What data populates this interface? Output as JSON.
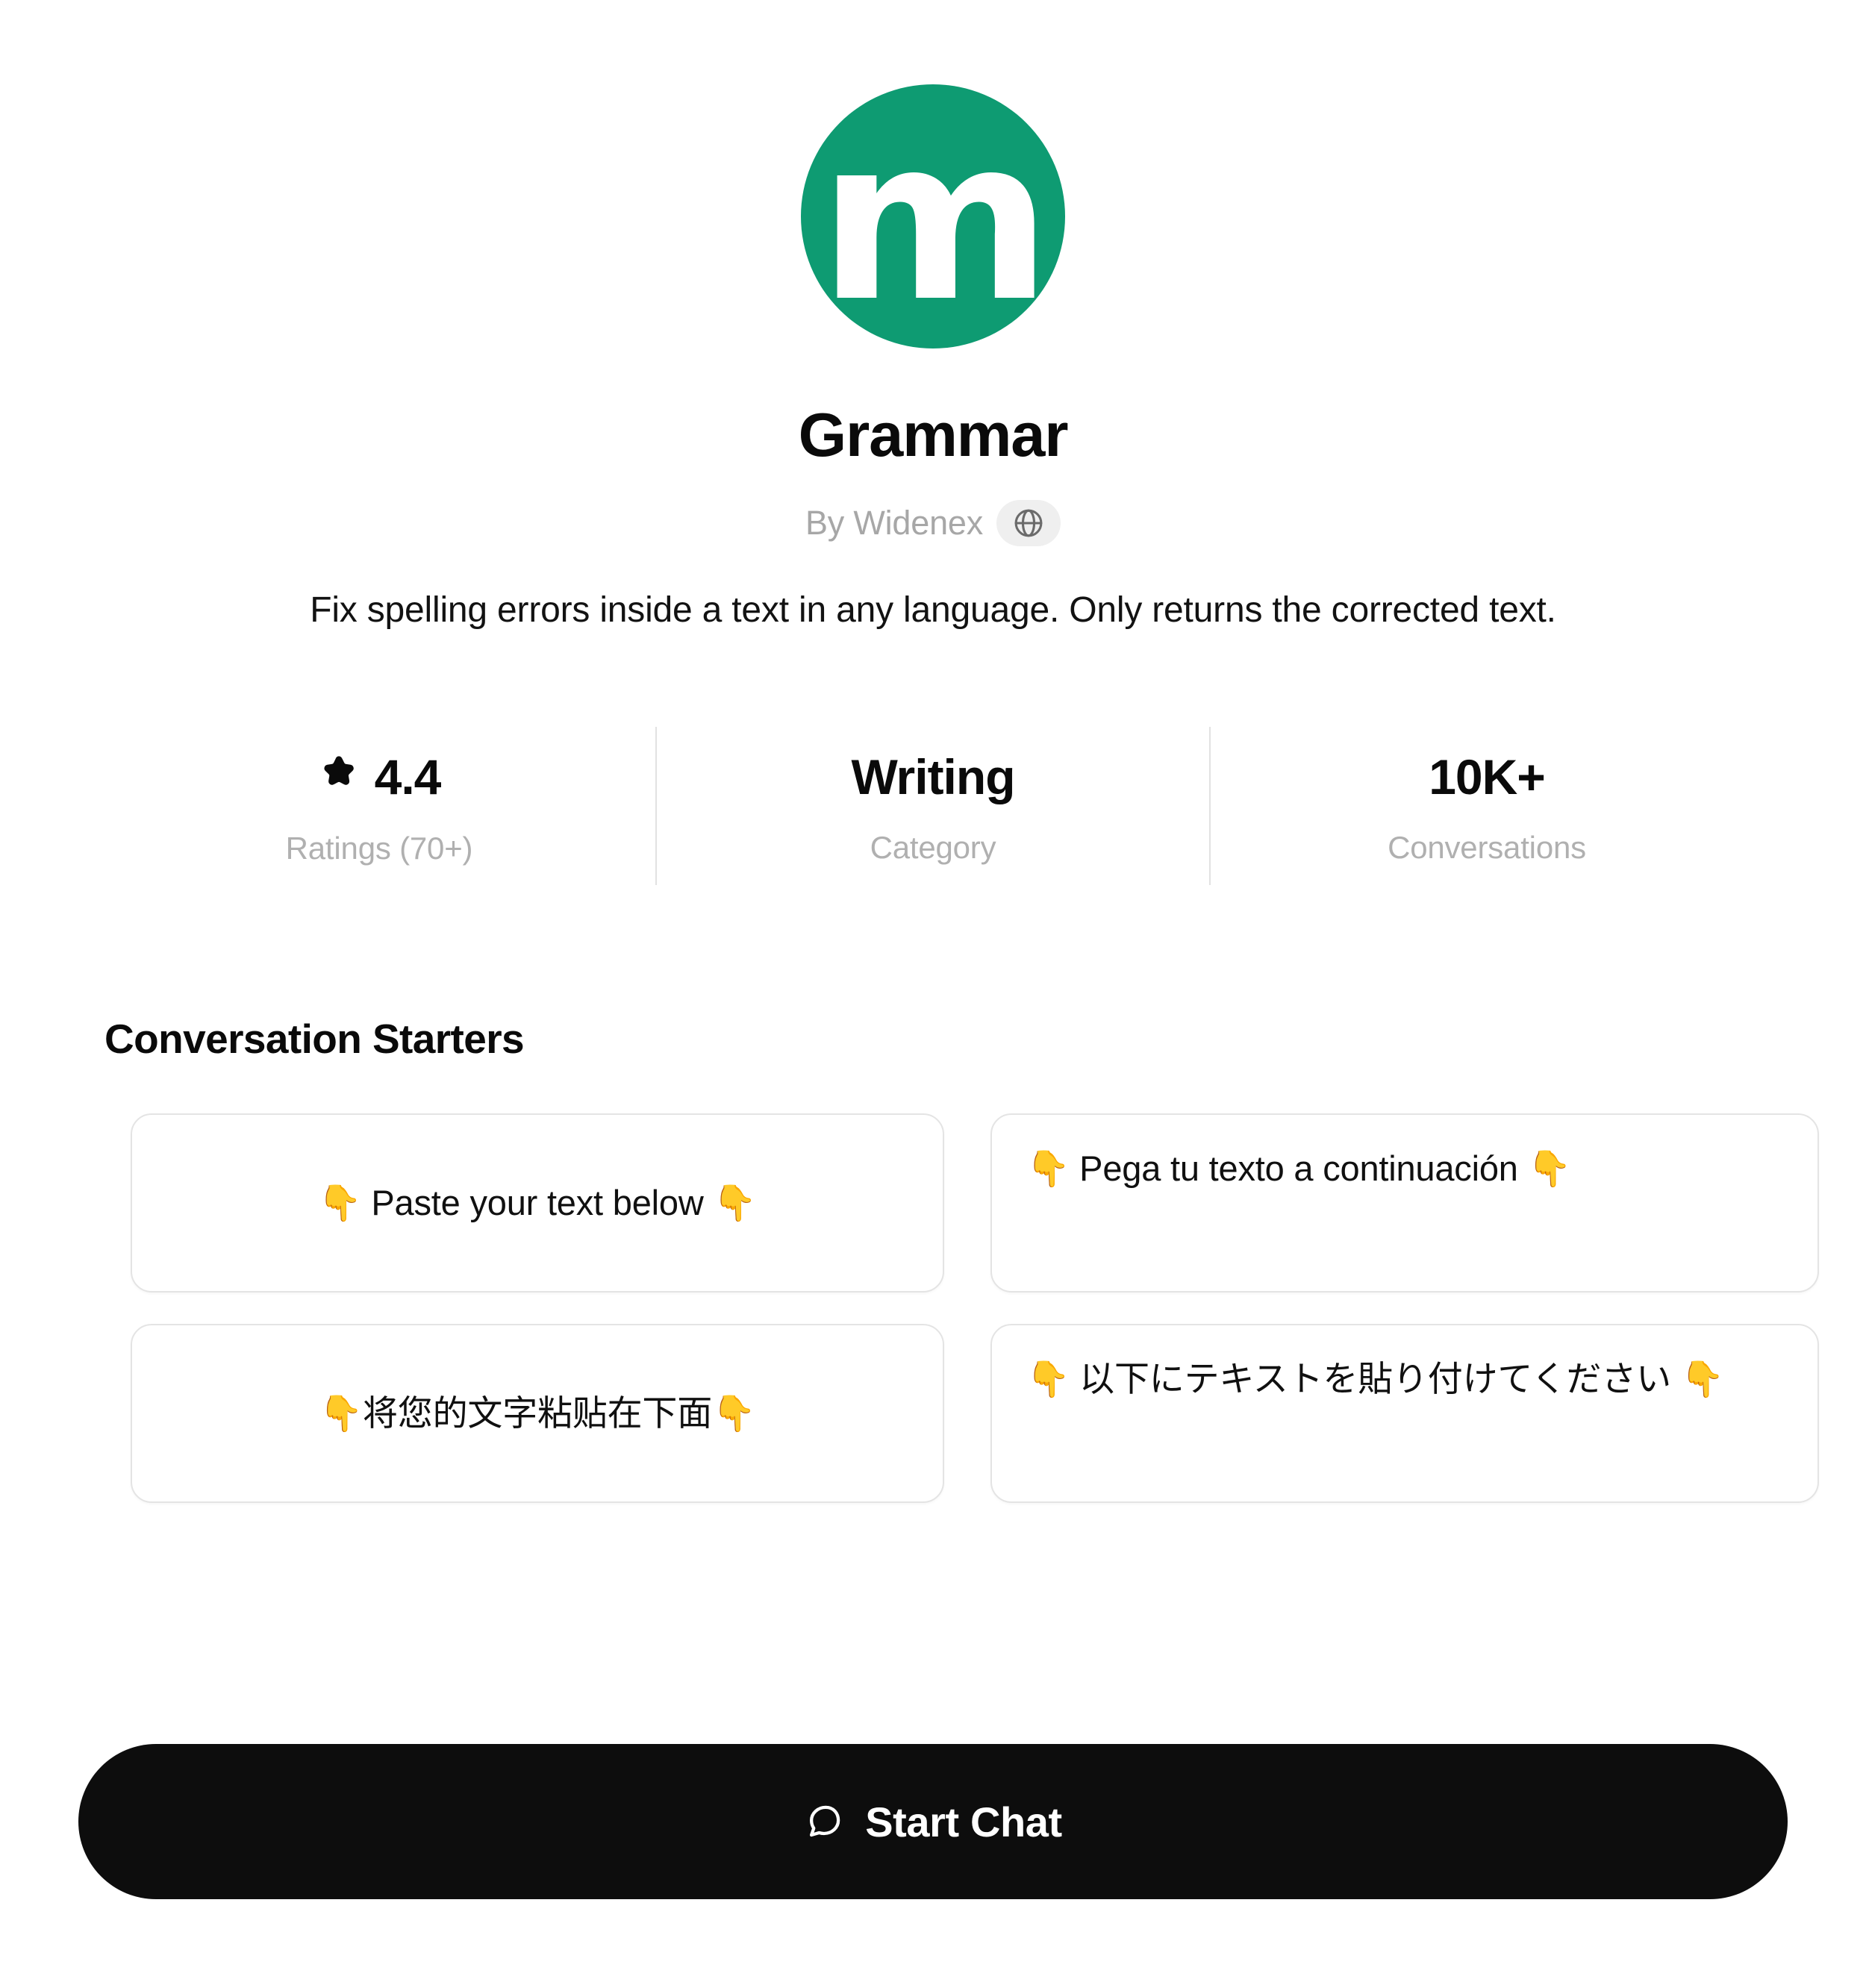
{
  "app": {
    "logo_letter": "m",
    "logo_color": "#0e9b72",
    "title": "Grammar",
    "byline": "By Widenex",
    "byline_icon": "globe-icon",
    "description": "Fix spelling errors inside a text in any language. Only returns the corrected text."
  },
  "stats": [
    {
      "icon": "star-icon",
      "value": "4.4",
      "label": "Ratings (70+)"
    },
    {
      "icon": null,
      "value": "Writing",
      "label": "Category"
    },
    {
      "icon": null,
      "value": "10K+",
      "label": "Conversations"
    }
  ],
  "conversation_starters": {
    "heading": "Conversation Starters",
    "items": [
      {
        "text": "👇 Paste your text below 👇"
      },
      {
        "text": "👇 Pega tu texto a continuación 👇"
      },
      {
        "text": "👇将您的文字粘贴在下面👇"
      },
      {
        "text": "👇 以下にテキストを貼り付けてください 👇"
      }
    ]
  },
  "primary_action": {
    "label": "Start Chat",
    "icon": "chat-bubble-icon",
    "background": "#0d0d0d"
  }
}
